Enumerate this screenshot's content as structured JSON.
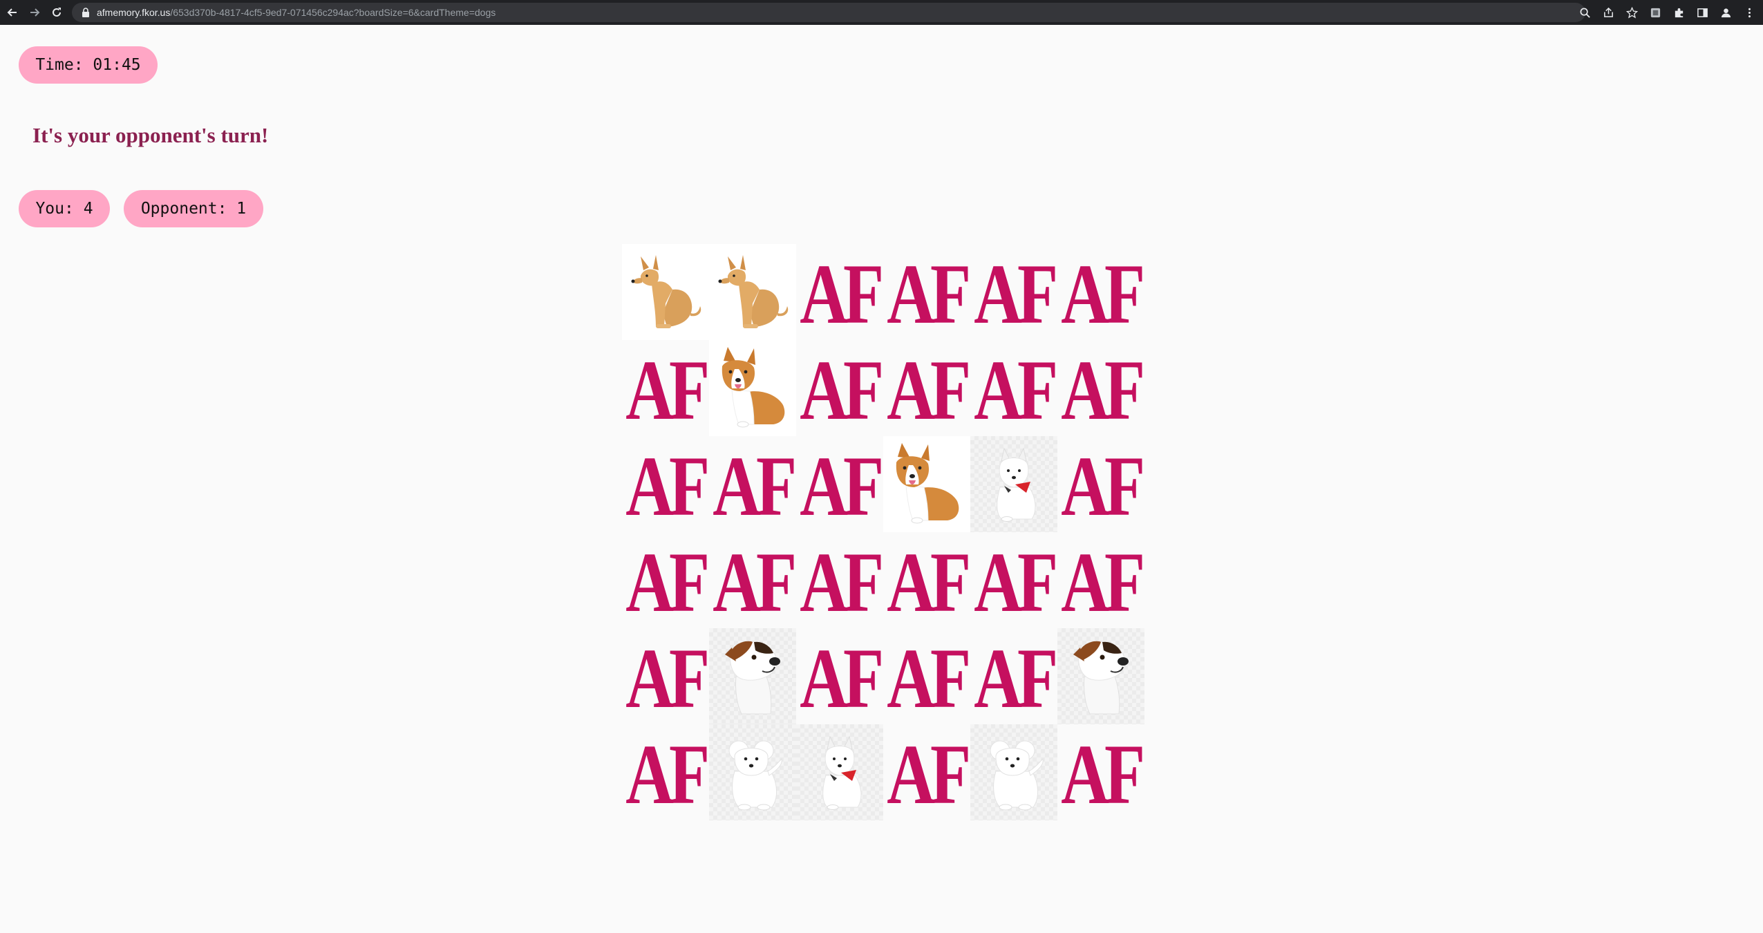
{
  "browser": {
    "url_host": "afmemory.fkor.us",
    "url_rest": "/653d370b-4817-4cf5-9ed7-071456c294ac?boardSize=6&cardTheme=dogs",
    "icons": [
      "back-arrow-icon",
      "forward-arrow-icon",
      "reload-icon",
      "lock-icon",
      "zoom-icon",
      "share-icon",
      "star-icon",
      "extension-puzzle-icon",
      "sidebar-icon",
      "profile-icon",
      "kebab-menu-icon"
    ]
  },
  "game": {
    "timer": "Time: 01:45",
    "turn_message": "It's your opponent's turn!",
    "score_you": "You: 4",
    "score_opponent": "Opponent: 1",
    "card_back_text": "AF",
    "colors": {
      "pill": "#ffa6c5",
      "card_back": "#c5105f",
      "turn_message": "#8b2150"
    },
    "board": [
      [
        "tan-dog",
        "tan-dog",
        "back",
        "back",
        "back",
        "back"
      ],
      [
        "back",
        "corgi",
        "back",
        "back",
        "back",
        "back"
      ],
      [
        "back",
        "back",
        "back",
        "corgi",
        "white-spitz",
        "back"
      ],
      [
        "back",
        "back",
        "back",
        "back",
        "back",
        "back"
      ],
      [
        "back",
        "jack-russell",
        "back",
        "back",
        "back",
        "jack-russell"
      ],
      [
        "back",
        "bichon",
        "white-spitz",
        "back",
        "bichon",
        "back"
      ]
    ]
  }
}
